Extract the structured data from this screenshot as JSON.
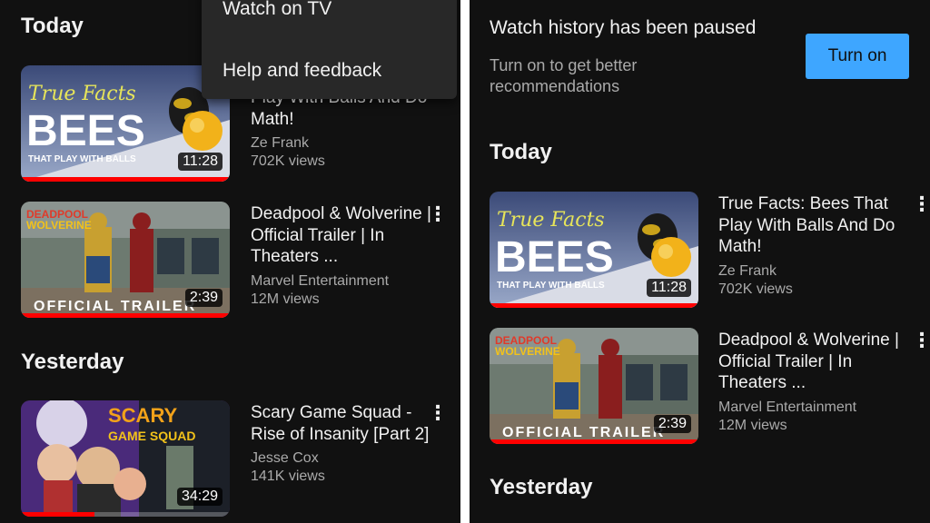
{
  "left": {
    "menu": {
      "items": [
        "Watch on TV",
        "Help and feedback"
      ]
    },
    "sections": {
      "today": "Today",
      "yesterday": "Yesterday"
    },
    "videos": [
      {
        "title": "Play With Balls And Do Math!",
        "channel": "Ze Frank",
        "views": "702K views",
        "duration": "11:28",
        "progress": 1.0
      },
      {
        "title": "Deadpool & Wolverine | Official Trailer | In Theaters ...",
        "channel": "Marvel Entertainment",
        "views": "12M views",
        "duration": "2:39",
        "progress": 1.0
      },
      {
        "title": "Scary Game Squad - Rise of Insanity [Part 2]",
        "channel": "Jesse Cox",
        "views": "141K views",
        "duration": "34:29",
        "progress": 0.35
      }
    ]
  },
  "right": {
    "banner": {
      "title": "Watch history has been paused",
      "subtitle": "Turn on to get better recommendations",
      "button": "Turn on"
    },
    "sections": {
      "today": "Today",
      "yesterday": "Yesterday"
    },
    "videos": [
      {
        "title": "True Facts: Bees That Play With Balls And Do Math!",
        "channel": "Ze Frank",
        "views": "702K views",
        "duration": "11:28",
        "progress": 1.0
      },
      {
        "title": "Deadpool & Wolverine | Official Trailer | In Theaters ...",
        "channel": "Marvel Entertainment",
        "views": "12M views",
        "duration": "2:39",
        "progress": 1.0
      }
    ]
  },
  "thumbnails": {
    "bees": {
      "script": "True Facts",
      "big": "BEES",
      "small": "THAT PLAY WITH BALLS"
    },
    "deadpool": {
      "logo_top": "DEADPOOL",
      "logo_bottom": "WOLVERINE",
      "banner": "OFFICIAL TRAILER"
    },
    "scary": {
      "logo_top": "SCARY",
      "logo_bottom": "GAME SQUAD"
    }
  },
  "colors": {
    "background": "#0f0f0f",
    "accent": "#3ea6ff",
    "progress": "#ff0000",
    "secondary_text": "#aaaaaa"
  },
  "icons": {
    "more": "more-vert-icon"
  }
}
